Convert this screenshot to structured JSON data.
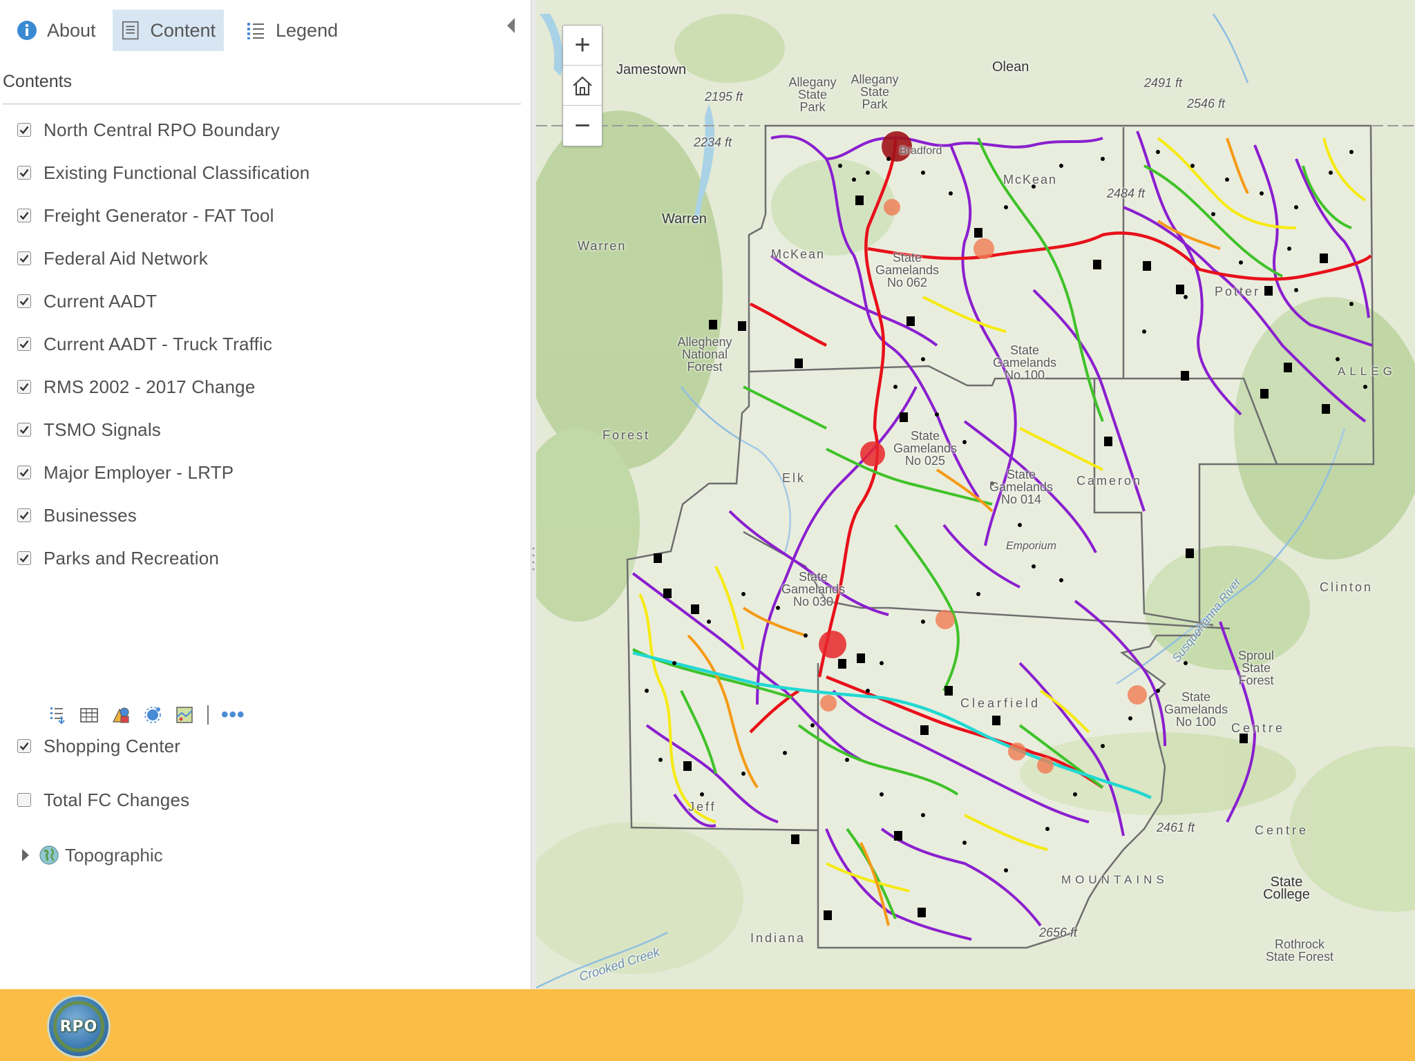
{
  "tabs": {
    "about": "About",
    "content": "Content",
    "legend": "Legend"
  },
  "contents": {
    "title": "Contents",
    "layers": [
      {
        "label": "North Central RPO Boundary",
        "checked": true
      },
      {
        "label": "Existing Functional Classification",
        "checked": true
      },
      {
        "label": "Freight Generator - FAT Tool",
        "checked": true
      },
      {
        "label": "Federal Aid Network",
        "checked": true
      },
      {
        "label": "Current AADT",
        "checked": true
      },
      {
        "label": "Current AADT - Truck Traffic",
        "checked": true
      },
      {
        "label": "RMS 2002 - 2017 Change",
        "checked": true
      },
      {
        "label": "TSMO Signals",
        "checked": true
      },
      {
        "label": "Major Employer - LRTP",
        "checked": true
      },
      {
        "label": "Businesses",
        "checked": true
      },
      {
        "label": "Parks and Recreation",
        "checked": true
      },
      {
        "label": "Shopping Center",
        "checked": true
      },
      {
        "label": "Total FC Changes",
        "checked": false
      }
    ],
    "basemap": "Topographic",
    "more_label": "•••"
  },
  "map": {
    "zoom_in": "+",
    "zoom_out": "−",
    "labels": {
      "jamestown": "Jamestown",
      "olean": "Olean",
      "warren_city": "Warren",
      "warren_county": "Warren",
      "allegany_state_park_1": "Allegany State Park",
      "allegany_state_park_2": "Allegany State Park",
      "elev_2195": "2195 ft",
      "elev_2234": "2234 ft",
      "elev_2491": "2491 ft",
      "elev_2546": "2546 ft",
      "elev_2484": "2484 ft",
      "elev_2461": "2461 ft",
      "elev_2656": "2656 ft",
      "mckean_north": "McKean",
      "mckean_west": "McKean",
      "allegheny_nf": "Allegheny National Forest",
      "forest": "Forest",
      "elk": "Elk",
      "cameron": "Cameron",
      "potter": "Potter",
      "clearfield": "Clearfield",
      "clinton": "Clinton",
      "centre_1": "Centre",
      "centre_2": "Centre",
      "state_college": "State College",
      "sproul_sf": "Sproul State Forest",
      "rothrock_sf": "Rothrock State Forest",
      "sgl_100": "State Gamelands No 100",
      "sgl_014": "State Gamelands No 014",
      "sgl_025": "State Gamelands No 025",
      "sgl_030": "State Gamelands No 030",
      "sgl_062": "State Gamelands No 062",
      "sgl_clearfield": "State Gamelands No 100",
      "indiana": "Indiana",
      "crooked_creek": "Crooked Creek",
      "mountains": "MOUNTAINS",
      "allegheny_right": "ALLEG",
      "bradford": "Bradford",
      "jefferson": "Jeff",
      "emporium": "Emporium",
      "susquehanna": "Susquehanna River"
    }
  },
  "footer": {
    "logo_text": "RPO"
  },
  "colors": {
    "tab_active_bg": "#d8e6f3",
    "footer": "#fbbd45",
    "purple": "#8a1fcf",
    "red": "#e8101a",
    "green": "#3fc22a",
    "yellow": "#f6ea12",
    "orange": "#f59a16",
    "cyan": "#22d8d2",
    "boundary": "#6e6e6e"
  }
}
